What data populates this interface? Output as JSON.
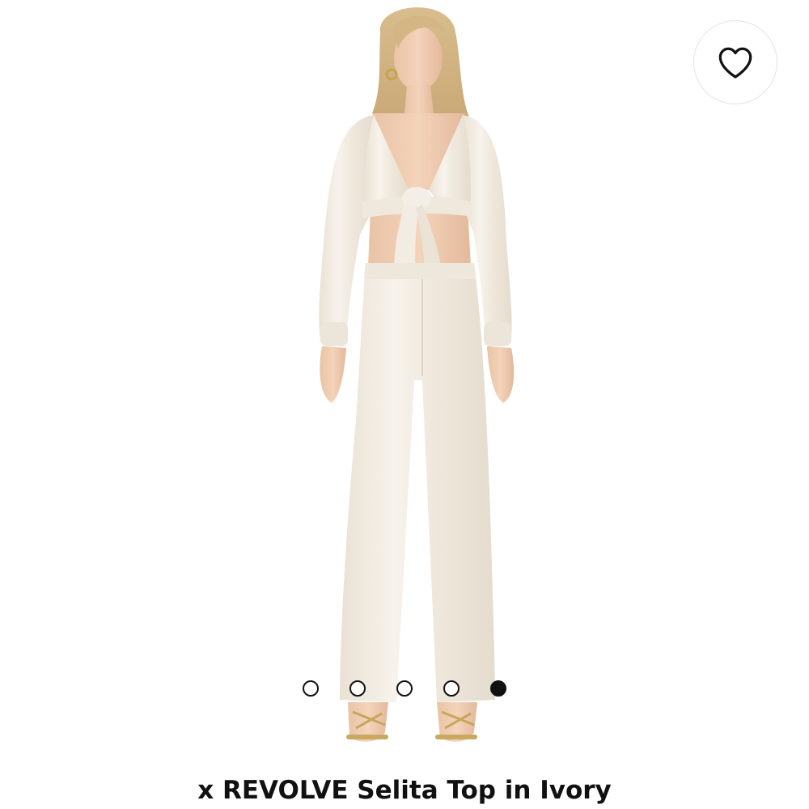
{
  "product": {
    "title": "x REVOLVE Selita Top in Ivory",
    "image_alt": "Model wearing ivory satin tie-front long sleeve crop top with matching wide-leg pants"
  },
  "favorite": {
    "icon": "heart-outline-icon"
  },
  "carousel": {
    "total": 5,
    "active_index": 4
  },
  "colors": {
    "background": "#ffffff",
    "text": "#111111",
    "dot_border": "#111111",
    "garment_ivory": "#f1ebe0"
  }
}
